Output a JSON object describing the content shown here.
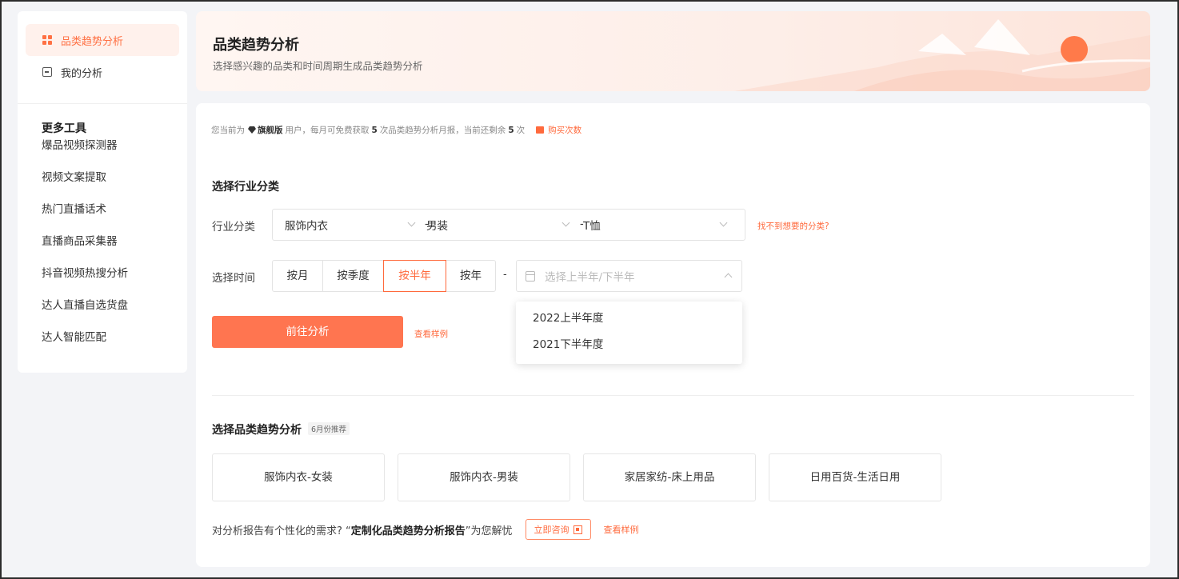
{
  "sidebar": {
    "items": [
      {
        "label": "品类趋势分析",
        "icon": "grid-icon",
        "active": true
      },
      {
        "label": "我的分析",
        "icon": "list-box-icon",
        "active": false
      }
    ],
    "more_title": "更多工具",
    "tools": [
      "爆品视频探测器",
      "视频文案提取",
      "热门直播话术",
      "直播商品采集器",
      "抖音视频热搜分析",
      "达人直播自选货盘",
      "达人智能匹配"
    ]
  },
  "banner": {
    "title": "品类趋势分析",
    "subtitle": "选择感兴趣的品类和时间周期生成品类趋势分析"
  },
  "notice": {
    "prefix": "您当前为",
    "level": "旗舰版",
    "middle": "用户，每月可免费获取",
    "free_count": "5",
    "middle2": "次品类趋势分析月报，当前还剩余",
    "remain_count": "5",
    "suffix": "次",
    "buy_label": "购买次数"
  },
  "industry": {
    "section_title": "选择行业分类",
    "row_label": "行业分类",
    "level1": "服饰内衣",
    "separator": "-",
    "level2": "男装",
    "level3": "T恤",
    "not_found_link": "找不到想要的分类?"
  },
  "time": {
    "row_label": "选择时间",
    "options": [
      "按月",
      "按季度",
      "按半年",
      "按年"
    ],
    "active_option": "按半年",
    "separator": "-",
    "date_placeholder": "选择上半年/下半年",
    "dropdown_options": [
      "2022上半年度",
      "2021下半年度"
    ]
  },
  "actions": {
    "go_label": "前往分析",
    "sample_label": "查看样例"
  },
  "recommend": {
    "title": "选择品类趋势分析",
    "badge": "6月份推荐",
    "cards": [
      "服饰内衣-女装",
      "服饰内衣-男装",
      "家居家纺-床上用品",
      "日用百货-生活日用"
    ]
  },
  "footer": {
    "question": "对分析报告有个性化的需求? “",
    "bold": "定制化品类趋势分析报告",
    "tail": "”为您解忧",
    "consult_label": "立即咨询",
    "sample_label": "查看样例"
  },
  "colors": {
    "accent": "#ff7043",
    "button": "#ff7550"
  }
}
